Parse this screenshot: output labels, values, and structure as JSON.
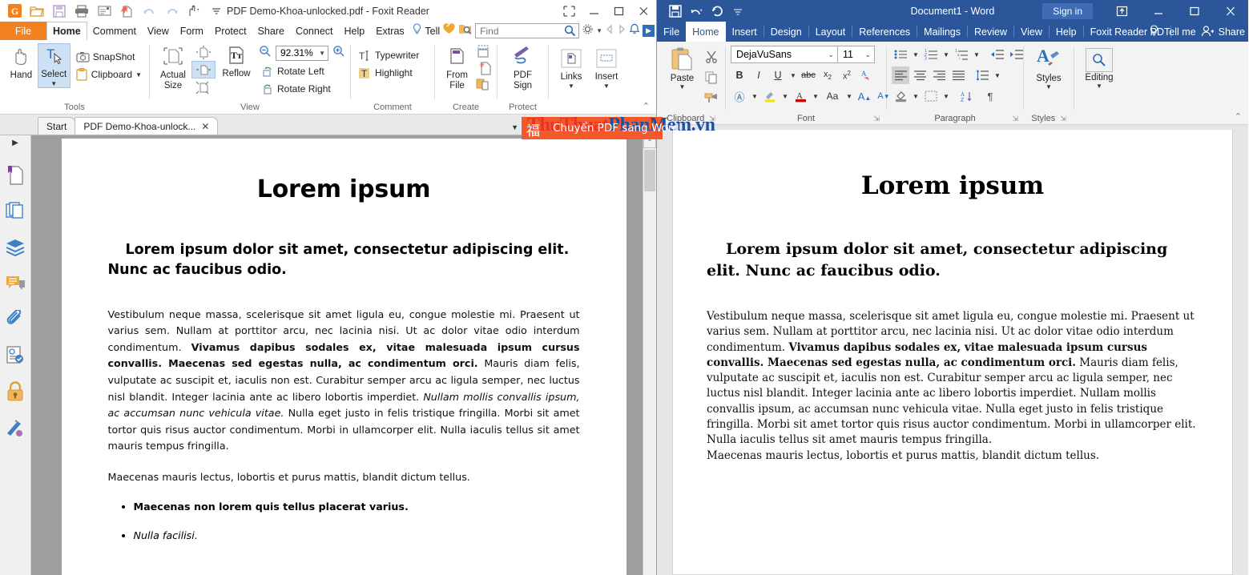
{
  "foxit": {
    "title": "PDF Demo-Khoa-unlocked.pdf - Foxit Reader",
    "quick_access": [
      {
        "name": "foxit-logo-icon",
        "glyph": "G"
      },
      {
        "name": "open-icon",
        "glyph": "open"
      },
      {
        "name": "save-icon",
        "glyph": "save"
      },
      {
        "name": "print-icon",
        "glyph": "print"
      },
      {
        "name": "email-icon",
        "glyph": "email"
      },
      {
        "name": "new-icon",
        "glyph": "new"
      },
      {
        "name": "undo-icon",
        "glyph": "undo"
      },
      {
        "name": "redo-icon",
        "glyph": "redo"
      },
      {
        "name": "touch-mode-icon",
        "glyph": "touch"
      },
      {
        "name": "customize-qat-icon",
        "glyph": "caret"
      }
    ],
    "window_buttons": [
      "restore-layout",
      "minimize",
      "maximize",
      "close"
    ],
    "file_menu": "File",
    "tabs": [
      "Home",
      "Comment",
      "View",
      "Form",
      "Protect",
      "Share",
      "Connect",
      "Help",
      "Extras"
    ],
    "active_tab": "Home",
    "tell_label": "Tell",
    "find_placeholder": "Find",
    "find_value": "",
    "ribbon": {
      "groups": [
        {
          "label": "Tools",
          "big": [
            {
              "label": "Hand",
              "name": "hand-tool-button",
              "selected": false
            },
            {
              "label": "Select",
              "name": "select-tool-button",
              "selected": true
            }
          ],
          "small": [
            {
              "label": "SnapShot",
              "name": "snapshot-button"
            },
            {
              "label": "Clipboard",
              "name": "clipboard-button",
              "caret": true
            }
          ]
        },
        {
          "label": "View",
          "big": [
            {
              "label": "Actual Size",
              "name": "actual-size-button"
            },
            {
              "label": "Reflow",
              "name": "reflow-button"
            }
          ],
          "zoom_value": "92.31%",
          "small": [
            {
              "label": "Rotate Left",
              "name": "rotate-left-button"
            },
            {
              "label": "Rotate Right",
              "name": "rotate-right-button"
            }
          ]
        },
        {
          "label": "Comment",
          "small": [
            {
              "label": "Typewriter",
              "name": "typewriter-button"
            },
            {
              "label": "Highlight",
              "name": "highlight-button"
            }
          ]
        },
        {
          "label": "Create",
          "big": [
            {
              "label": "From File",
              "name": "create-from-file-button"
            }
          ]
        },
        {
          "label": "Protect",
          "big": [
            {
              "label": "PDF Sign",
              "name": "pdf-sign-button"
            }
          ]
        },
        {
          "label": "",
          "big": [
            {
              "label": "Links",
              "name": "links-button",
              "caret": true
            },
            {
              "label": "Insert",
              "name": "insert-button",
              "caret": true
            }
          ]
        }
      ]
    },
    "doc_tabs": [
      {
        "label": "Start",
        "active": false,
        "closable": false
      },
      {
        "label": "PDF Demo-Khoa-unlock...",
        "active": true,
        "closable": true
      }
    ],
    "nav_icons": [
      {
        "name": "bookmark-panel-icon"
      },
      {
        "name": "pages-panel-icon"
      },
      {
        "name": "layers-panel-icon"
      },
      {
        "name": "comments-panel-icon"
      },
      {
        "name": "attachments-panel-icon"
      },
      {
        "name": "digital-id-panel-icon"
      },
      {
        "name": "security-panel-icon"
      },
      {
        "name": "signatures-panel-icon"
      }
    ],
    "document": {
      "h1": "Lorem ipsum",
      "h2": "Lorem ipsum dolor sit amet, consectetur adipiscing elit. Nunc ac faucibus odio.",
      "p1_a": "Vestibulum neque massa, scelerisque sit amet ligula eu, congue molestie mi. Praesent ut varius sem. Nullam at porttitor arcu, nec lacinia nisi. Ut ac dolor vitae odio interdum condimentum. ",
      "p1_bold": "Vivamus dapibus sodales ex, vitae malesuada ipsum cursus convallis. Maecenas sed egestas nulla, ac condimentum orci.",
      "p1_b": " Mauris diam felis, vulputate ac suscipit et, iaculis non est. Curabitur semper arcu ac ligula semper, nec luctus nisl blandit. Integer lacinia ante ac libero lobortis imperdiet. ",
      "p1_italic": "Nullam mollis convallis ipsum, ac accumsan nunc vehicula vitae.",
      "p1_c": " Nulla eget justo in felis tristique fringilla. Morbi sit amet tortor quis risus auctor condimentum. Morbi in ullamcorper elit. Nulla iaculis tellus sit amet mauris tempus fringilla.",
      "p2": "Maecenas mauris lectus, lobortis et purus mattis, blandit dictum tellus.",
      "bullets": [
        {
          "text": "Maecenas non lorem quis tellus placerat varius.",
          "style": "bold"
        },
        {
          "text": "Nulla facilisi.",
          "style": "italic"
        }
      ]
    }
  },
  "word": {
    "title": "Document1  -  Word",
    "quick_access": [
      {
        "name": "save-icon"
      },
      {
        "name": "undo-icon"
      },
      {
        "name": "redo-icon"
      },
      {
        "name": "customize-qat-icon"
      }
    ],
    "signin_label": "Sign in",
    "window_buttons": [
      "ribbon-display-options",
      "minimize",
      "maximize",
      "close"
    ],
    "tabs": [
      "File",
      "Home",
      "Insert",
      "Design",
      "Layout",
      "References",
      "Mailings",
      "Review",
      "View",
      "Help",
      "Foxit Reader PD"
    ],
    "active_tab": "Home",
    "tell_me": "Tell me",
    "share": "Share",
    "ribbon": {
      "clipboard": {
        "label": "Clipboard",
        "paste": "Paste",
        "items": [
          "cut-icon",
          "copy-icon",
          "format-painter-icon"
        ]
      },
      "font": {
        "label": "Font",
        "font_name": "DejaVuSans",
        "font_size": "11",
        "row1": [
          "bold-icon",
          "italic-icon",
          "underline-icon",
          "strikethrough-icon",
          "subscript-icon",
          "superscript-icon",
          "clear-formatting-icon"
        ],
        "row2": [
          "text-effects-icon",
          "text-highlight-icon",
          "font-color-icon",
          "change-case-icon",
          "grow-font-icon",
          "shrink-font-icon"
        ]
      },
      "paragraph": {
        "label": "Paragraph",
        "row1": [
          "bullets-icon",
          "numbering-icon",
          "multilevel-list-icon",
          "decrease-indent-icon",
          "increase-indent-icon"
        ],
        "row2": [
          "align-left-icon",
          "align-center-icon",
          "align-right-icon",
          "justify-icon",
          "line-spacing-icon"
        ],
        "row3": [
          "shading-icon",
          "borders-icon",
          "sort-icon",
          "show-marks-icon"
        ]
      },
      "styles": {
        "label": "Styles",
        "button": "Styles"
      },
      "editing": {
        "label": "",
        "button": "Editing"
      }
    },
    "document": {
      "h1": "Lorem ipsum",
      "h2": "Lorem ipsum dolor sit amet, consectetur adipiscing elit. Nunc ac faucibus odio.",
      "p1_a": "Vestibulum neque massa, scelerisque sit amet ligula eu, congue molestie mi. Praesent ut varius sem. Nullam at porttitor arcu, nec lacinia nisi. Ut ac dolor vitae odio interdum condimentum. ",
      "p1_bold": "Vivamus dapibus sodales ex, vitae malesuada ipsum cursus convallis. Maecenas sed egestas nulla, ac condimentum orci.",
      "p1_b": " Mauris diam felis, vulputate ac suscipit et, iaculis non est. Curabitur semper arcu ac ligula semper, nec luctus nisl blandit. Integer lacinia ante ac libero lobortis imperdiet. Nullam mollis convallis ipsum, ac accumsan nunc vehicula vitae. Nulla eget justo in felis tristique fringilla. Morbi sit amet tortor quis risus auctor condimentum. Morbi in ullamcorper elit. Nulla iaculis tellus sit amet mauris tempus fringilla.",
      "p2": "Maecenas mauris lectus, lobortis et purus mattis, blandit dictum tellus."
    }
  },
  "watermark": {
    "part1": "ThuThuat",
    "part2": "PhanMem",
    "part3": ".vn",
    "cjk": "福",
    "sub": "Chuyển PDF sang Word",
    "color_red": "#e8322a",
    "color_blue": "#1f4fa3",
    "color_box": "#f4592a"
  }
}
